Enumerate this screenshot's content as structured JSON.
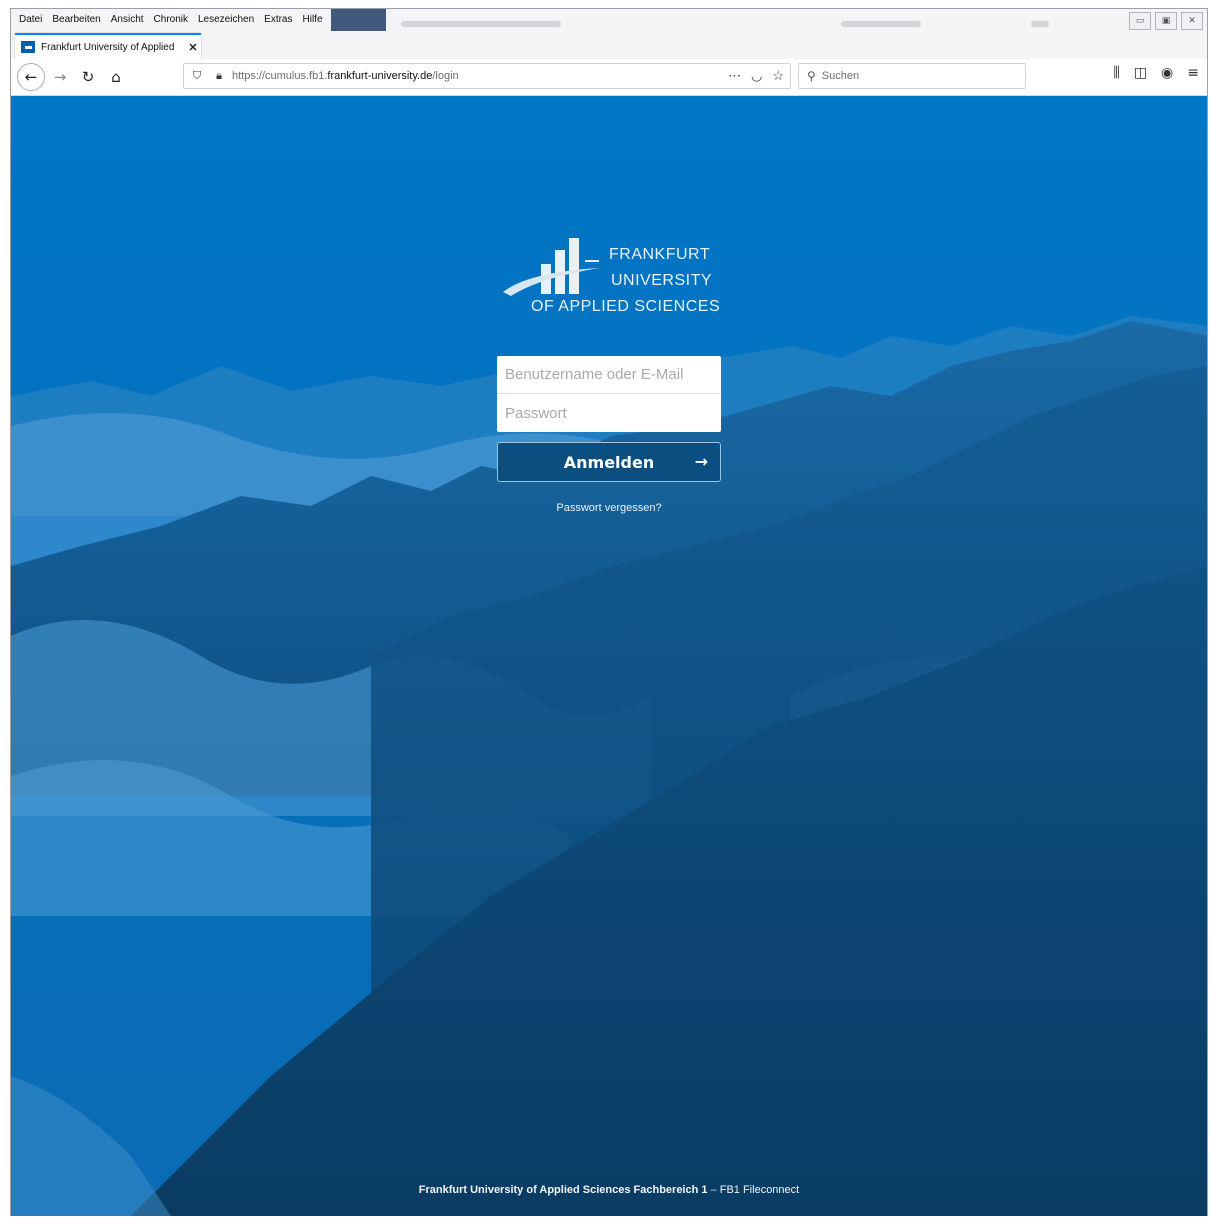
{
  "browser": {
    "menu": [
      "Datei",
      "Bearbeiten",
      "Ansicht",
      "Chronik",
      "Lesezeichen",
      "Extras",
      "Hilfe"
    ],
    "tab_title": "Frankfurt University of Applied",
    "url_prefix": "https://cumulus.fb1.",
    "url_domain": "frankfurt-university.de",
    "url_path": "/login",
    "search_placeholder": "Suchen"
  },
  "logo": {
    "line1": "FRANKFURT",
    "line2": "UNIVERSITY",
    "line3": "OF APPLIED SCIENCES"
  },
  "login": {
    "user_placeholder": "Benutzername oder E-Mail",
    "password_placeholder": "Passwort",
    "submit_label": "Anmelden",
    "forgot_label": "Passwort vergessen?"
  },
  "footer": {
    "entity": "Frankfurt University of Applied Sciences Fachbereich 1",
    "separator": " – ",
    "slogan": "FB1 Fileconnect"
  },
  "colors": {
    "brand_blue": "#0073c2",
    "button_dark": "#0a4f80"
  }
}
